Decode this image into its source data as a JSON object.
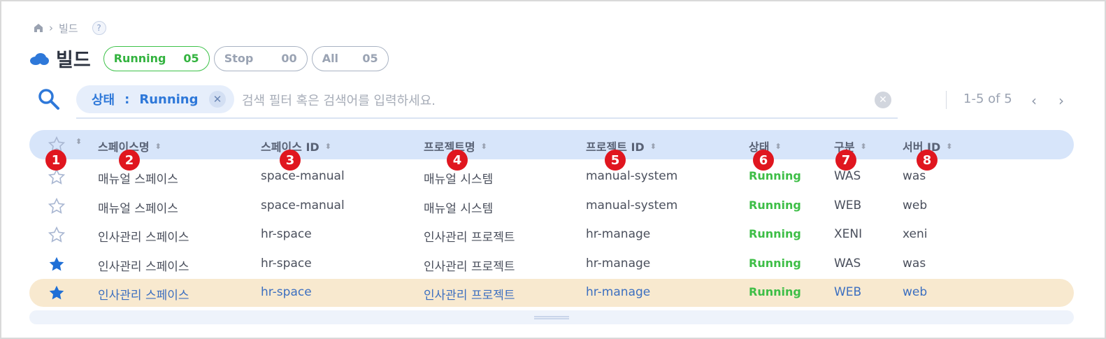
{
  "breadcrumb": {
    "current": "빌드",
    "help": "?"
  },
  "header": {
    "title": "빌드",
    "filters": [
      {
        "label": "Running",
        "count": "05"
      },
      {
        "label": "Stop",
        "count": "00"
      },
      {
        "label": "All",
        "count": "05"
      }
    ]
  },
  "search": {
    "chip_key": "상태",
    "chip_sep": ":",
    "chip_value": "Running",
    "placeholder": "검색 필터 혹은 검색어를 입력하세요."
  },
  "pager": {
    "text": "1-5 of 5",
    "prev": "‹",
    "next": "›"
  },
  "columns": [
    "스페이스명",
    "스페이스 ID",
    "프로젝트명",
    "프로젝트 ID",
    "상태",
    "구분",
    "서버 ID"
  ],
  "rows": [
    {
      "starred": false,
      "space_name": "매뉴얼 스페이스",
      "space_id": "space-manual",
      "project_name": "매뉴얼 시스템",
      "project_id": "manual-system",
      "status": "Running",
      "type": "WAS",
      "server_id": "was"
    },
    {
      "starred": false,
      "space_name": "매뉴얼 스페이스",
      "space_id": "space-manual",
      "project_name": "매뉴얼 시스템",
      "project_id": "manual-system",
      "status": "Running",
      "type": "WEB",
      "server_id": "web"
    },
    {
      "starred": false,
      "space_name": "인사관리 스페이스",
      "space_id": "hr-space",
      "project_name": "인사관리 프로젝트",
      "project_id": "hr-manage",
      "status": "Running",
      "type": "XENI",
      "server_id": "xeni"
    },
    {
      "starred": true,
      "space_name": "인사관리 스페이스",
      "space_id": "hr-space",
      "project_name": "인사관리 프로젝트",
      "project_id": "hr-manage",
      "status": "Running",
      "type": "WAS",
      "server_id": "was"
    },
    {
      "starred": true,
      "space_name": "인사관리 스페이스",
      "space_id": "hr-space",
      "project_name": "인사관리 프로젝트",
      "project_id": "hr-manage",
      "status": "Running",
      "type": "WEB",
      "server_id": "web"
    }
  ],
  "badges": [
    "1",
    "2",
    "3",
    "4",
    "5",
    "6",
    "7",
    "8"
  ],
  "colors": {
    "accent": "#2e78d9",
    "running": "#3ebe47",
    "header_bg": "#d7e5fa",
    "selected_row": "#f8e9cf",
    "badge": "#e0161f"
  }
}
